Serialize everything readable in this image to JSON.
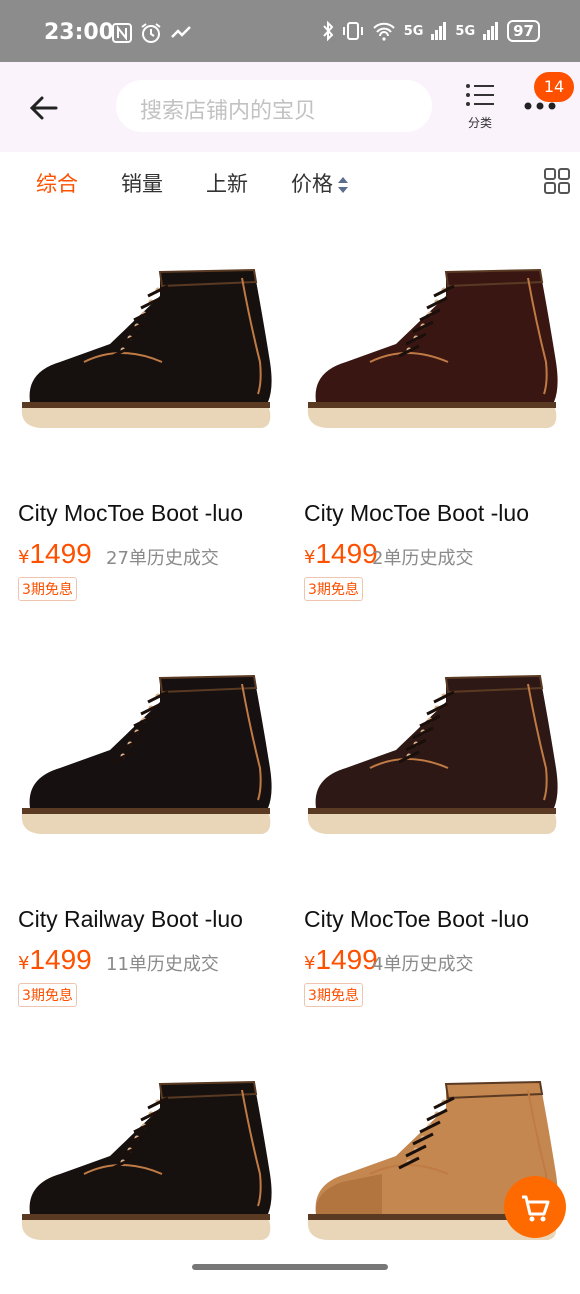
{
  "status_bar": {
    "time": "23:00",
    "battery": "97",
    "network_labels": [
      "5G",
      "5G"
    ]
  },
  "header": {
    "search_placeholder": "搜索店铺内的宝贝",
    "category_label": "分类",
    "message_badge": "14"
  },
  "sort_tabs": [
    {
      "label": "综合",
      "active": true
    },
    {
      "label": "销量",
      "active": false
    },
    {
      "label": "上新",
      "active": false
    },
    {
      "label": "价格",
      "active": false
    }
  ],
  "currency_symbol": "¥",
  "products": [
    {
      "title": "City MocToe Boot -luo",
      "price": "1499",
      "sold": "27单历史成交",
      "tag": "3期免息",
      "color": "#16110f",
      "style": "moc"
    },
    {
      "title": "City MocToe Boot -luo",
      "price": "1499",
      "sold": "2单历史成交",
      "tag": "3期免息",
      "color": "#3a1613",
      "style": "moc"
    },
    {
      "title": "City Railway Boot -luo",
      "price": "1499",
      "sold": "11单历史成交",
      "tag": "3期免息",
      "color": "#161011",
      "style": "plain"
    },
    {
      "title": "City MocToe Boot -luo",
      "price": "1499",
      "sold": "4单历史成交",
      "tag": "3期免息",
      "color": "#2e1815",
      "style": "moc"
    },
    {
      "title": "",
      "price": "",
      "sold": "",
      "tag": "",
      "color": "#16110f",
      "style": "moc"
    },
    {
      "title": "",
      "price": "",
      "sold": "",
      "tag": "",
      "color": "#c4874f",
      "style": "suede"
    }
  ],
  "colors": {
    "accent": "#ff5000",
    "header_bg": "#fbf3fb",
    "status_bg": "#8c8c8c",
    "sole": "#e9d6b8"
  }
}
